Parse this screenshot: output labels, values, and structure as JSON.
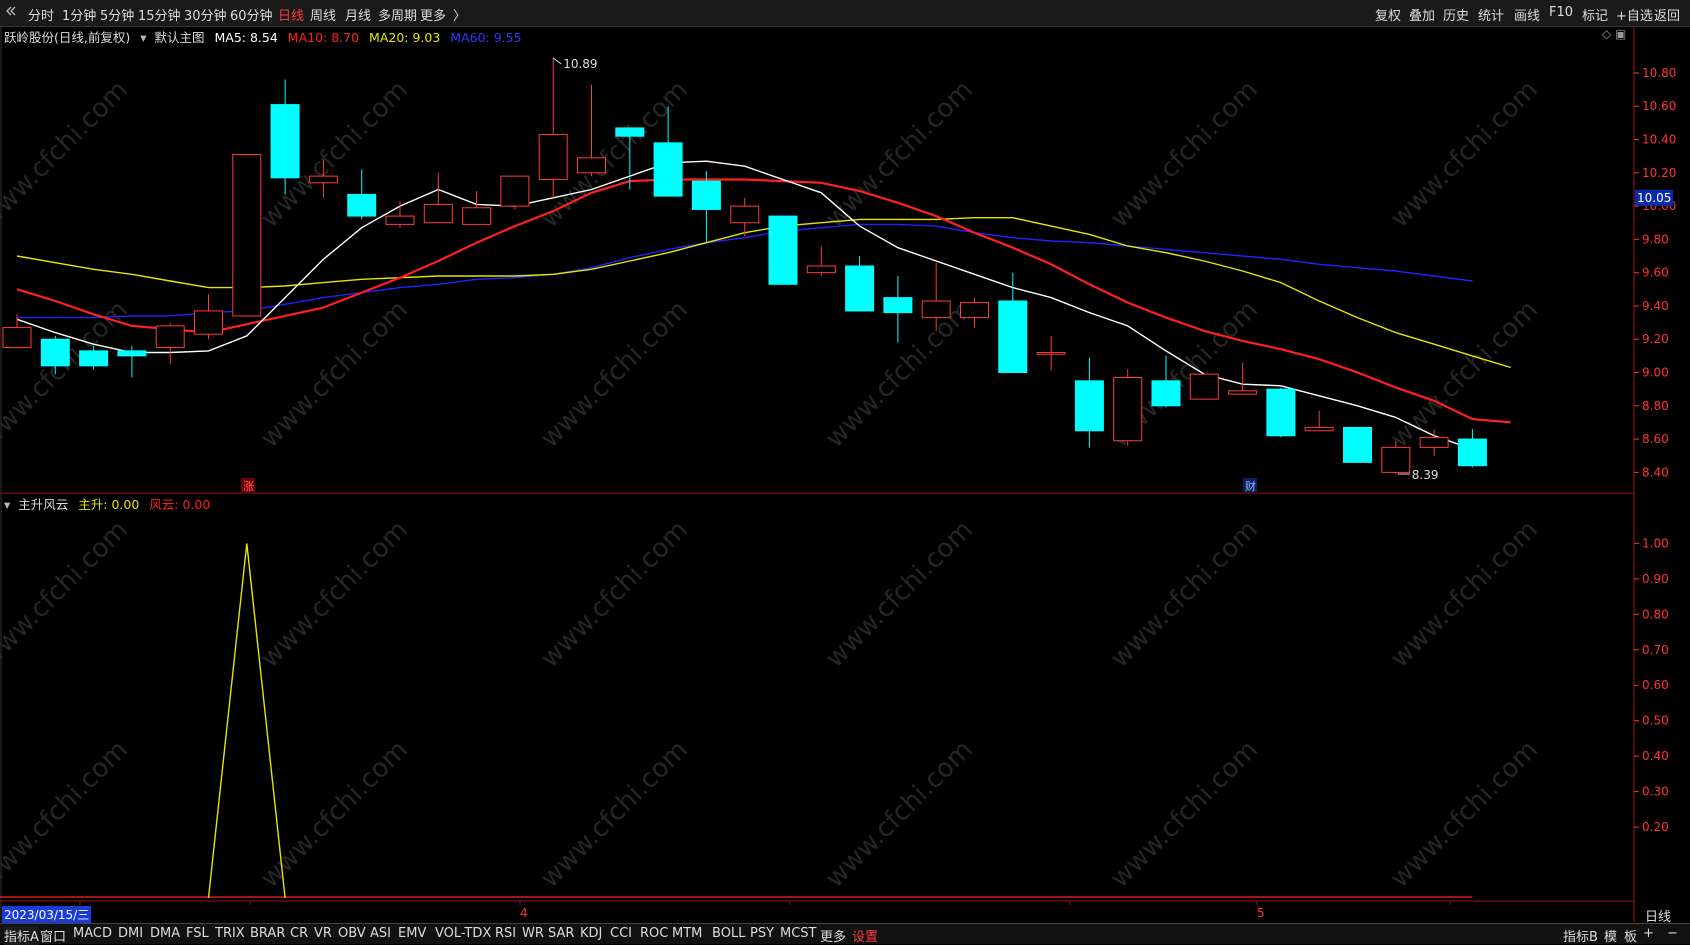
{
  "toolbar_left": [
    "分时",
    "1分钟",
    "5分钟",
    "15分钟",
    "30分钟",
    "60分钟",
    "日线",
    "周线",
    "月线",
    "多周期",
    "更多"
  ],
  "toolbar_active": "日线",
  "toolbar_more_icon": "chevron-right-icon",
  "toolbar_right": [
    "复权",
    "叠加",
    "历史",
    "统计",
    "画线",
    "F10",
    "标记",
    "+自选",
    "返回"
  ],
  "main_chart": {
    "title": "跃岭股份(日线,前复权)",
    "template": "默认主图",
    "ma5_label": "MA5: 8.54",
    "ma10_label": "MA10: 8.70",
    "ma20_label": "MA20: 9.03",
    "ma60_label": "MA60: 9.55",
    "high_annotation": "10.89",
    "low_annotation": "8.39",
    "current_price": "10.05",
    "y_ticks": [
      "10.80",
      "10.60",
      "10.40",
      "10.20",
      "10.00",
      "9.80",
      "9.60",
      "9.40",
      "9.20",
      "9.00",
      "8.80",
      "8.60",
      "8.40"
    ],
    "event_marker_zhang": "涨",
    "event_marker_cai": "财"
  },
  "sub_chart": {
    "title": "主升风云",
    "zhusheng_label": "主升: 0.00",
    "fengyun_label": "风云: 0.00",
    "y_ticks": [
      "1.00",
      "0.90",
      "0.80",
      "0.70",
      "0.60",
      "0.50",
      "0.40",
      "0.30",
      "0.20"
    ]
  },
  "date_label": "2023/03/15/三",
  "month_labels": [
    "4",
    "5"
  ],
  "period_label": "日线",
  "bottom_tabs": [
    "指标A",
    "窗口",
    "MACD",
    "DMI",
    "DMA",
    "FSL",
    "TRIX",
    "BRAR",
    "CR",
    "VR",
    "OBV",
    "ASI",
    "EMV",
    "VOL-TDX",
    "RSI",
    "WR",
    "SAR",
    "KDJ",
    "CCI",
    "ROC",
    "MTM",
    "BOLL",
    "PSY",
    "MCST",
    "更多",
    "设置"
  ],
  "bottom_right": [
    "指标B",
    "模",
    "板",
    "+",
    "−"
  ],
  "watermark": "www.cfchi.com",
  "colors": {
    "up": "#ff3a3a",
    "down": "#00ffff",
    "ma5": "#ffffff",
    "ma10": "#ff2020",
    "ma20": "#e6e600",
    "ma60": "#2222ff",
    "axis": "#ff3333"
  },
  "chart_data": {
    "type": "candlestick",
    "title": "跃岭股份(日线,前复权)",
    "ylim": [
      8.3,
      10.95
    ],
    "candles": [
      {
        "o": 9.15,
        "c": 9.27,
        "h": 9.35,
        "l": 9.15
      },
      {
        "o": 9.2,
        "c": 9.04,
        "h": 9.22,
        "l": 8.99
      },
      {
        "o": 9.13,
        "c": 9.04,
        "h": 9.16,
        "l": 9.02
      },
      {
        "o": 9.13,
        "c": 9.1,
        "h": 9.16,
        "l": 8.97
      },
      {
        "o": 9.15,
        "c": 9.28,
        "h": 9.3,
        "l": 9.05
      },
      {
        "o": 9.23,
        "c": 9.37,
        "h": 9.47,
        "l": 9.2
      },
      {
        "o": 9.34,
        "c": 10.31,
        "h": 10.31,
        "l": 9.34
      },
      {
        "o": 10.61,
        "c": 10.17,
        "h": 10.76,
        "l": 10.07
      },
      {
        "o": 10.14,
        "c": 10.18,
        "h": 10.28,
        "l": 10.05
      },
      {
        "o": 10.07,
        "c": 9.94,
        "h": 10.22,
        "l": 9.92
      },
      {
        "o": 9.89,
        "c": 9.94,
        "h": 10.03,
        "l": 9.87
      },
      {
        "o": 9.9,
        "c": 10.01,
        "h": 10.2,
        "l": 9.9
      },
      {
        "o": 9.89,
        "c": 9.99,
        "h": 10.09,
        "l": 9.89
      },
      {
        "o": 10.0,
        "c": 10.18,
        "h": 10.18,
        "l": 9.98
      },
      {
        "o": 10.16,
        "c": 10.43,
        "h": 10.89,
        "l": 10.05
      },
      {
        "o": 10.2,
        "c": 10.29,
        "h": 10.73,
        "l": 10.18
      },
      {
        "o": 10.47,
        "c": 10.42,
        "h": 10.47,
        "l": 10.1
      },
      {
        "o": 10.38,
        "c": 10.06,
        "h": 10.6,
        "l": 10.06
      },
      {
        "o": 10.15,
        "c": 9.98,
        "h": 10.21,
        "l": 9.78
      },
      {
        "o": 9.9,
        "c": 10.0,
        "h": 10.05,
        "l": 9.82
      },
      {
        "o": 9.94,
        "c": 9.53,
        "h": 9.94,
        "l": 9.53
      },
      {
        "o": 9.6,
        "c": 9.64,
        "h": 9.76,
        "l": 9.58
      },
      {
        "o": 9.64,
        "c": 9.37,
        "h": 9.7,
        "l": 9.37
      },
      {
        "o": 9.45,
        "c": 9.36,
        "h": 9.58,
        "l": 9.18
      },
      {
        "o": 9.33,
        "c": 9.43,
        "h": 9.66,
        "l": 9.25
      },
      {
        "o": 9.33,
        "c": 9.42,
        "h": 9.45,
        "l": 9.27
      },
      {
        "o": 9.43,
        "c": 9.0,
        "h": 9.6,
        "l": 9.0
      },
      {
        "o": 9.11,
        "c": 9.12,
        "h": 9.22,
        "l": 9.01
      },
      {
        "o": 8.95,
        "c": 8.65,
        "h": 9.09,
        "l": 8.55
      },
      {
        "o": 8.59,
        "c": 8.97,
        "h": 9.02,
        "l": 8.56
      },
      {
        "o": 8.95,
        "c": 8.8,
        "h": 9.1,
        "l": 8.79
      },
      {
        "o": 8.84,
        "c": 8.99,
        "h": 8.99,
        "l": 8.84
      },
      {
        "o": 8.87,
        "c": 8.89,
        "h": 9.06,
        "l": 8.87
      },
      {
        "o": 8.9,
        "c": 8.62,
        "h": 8.91,
        "l": 8.61
      },
      {
        "o": 8.65,
        "c": 8.67,
        "h": 8.77,
        "l": 8.65
      },
      {
        "o": 8.67,
        "c": 8.46,
        "h": 8.67,
        "l": 8.46
      },
      {
        "o": 8.4,
        "c": 8.55,
        "h": 8.59,
        "l": 8.39
      },
      {
        "o": 8.55,
        "c": 8.61,
        "h": 8.66,
        "l": 8.5
      },
      {
        "o": 8.6,
        "c": 8.44,
        "h": 8.66,
        "l": 8.43
      }
    ],
    "ma5": [
      9.32,
      9.24,
      9.17,
      9.12,
      9.12,
      9.13,
      9.22,
      9.45,
      9.68,
      9.87,
      10.0,
      10.1,
      10.01,
      10.0,
      10.05,
      10.1,
      10.18,
      10.26,
      10.27,
      10.24,
      10.16,
      10.08,
      9.88,
      9.75,
      9.67,
      9.59,
      9.51,
      9.45,
      9.36,
      9.28,
      9.13,
      8.99,
      8.93,
      8.92,
      8.86,
      8.8,
      8.73,
      8.62,
      8.54
    ],
    "ma10": [
      9.5,
      9.43,
      9.35,
      9.28,
      9.26,
      9.24,
      9.29,
      9.34,
      9.39,
      9.48,
      9.57,
      9.67,
      9.78,
      9.88,
      9.97,
      10.08,
      10.15,
      10.16,
      10.16,
      10.16,
      10.15,
      10.14,
      10.09,
      10.02,
      9.94,
      9.84,
      9.75,
      9.65,
      9.53,
      9.42,
      9.33,
      9.25,
      9.19,
      9.14,
      9.08,
      9.0,
      8.91,
      8.83,
      8.72,
      8.7
    ],
    "ma20": [
      9.7,
      9.66,
      9.62,
      9.59,
      9.55,
      9.51,
      9.51,
      9.52,
      9.54,
      9.56,
      9.57,
      9.58,
      9.58,
      9.58,
      9.59,
      9.62,
      9.67,
      9.72,
      9.78,
      9.84,
      9.88,
      9.9,
      9.92,
      9.92,
      9.92,
      9.93,
      9.93,
      9.88,
      9.83,
      9.76,
      9.72,
      9.67,
      9.61,
      9.54,
      9.43,
      9.33,
      9.24,
      9.17,
      9.1,
      9.03
    ],
    "ma60": [
      9.33,
      9.33,
      9.33,
      9.34,
      9.34,
      9.36,
      9.37,
      9.41,
      9.45,
      9.48,
      9.51,
      9.53,
      9.56,
      9.57,
      9.59,
      9.63,
      9.69,
      9.74,
      9.78,
      9.81,
      9.85,
      9.87,
      9.89,
      9.89,
      9.88,
      9.84,
      9.81,
      9.79,
      9.78,
      9.76,
      9.74,
      9.72,
      9.7,
      9.68,
      9.65,
      9.63,
      9.61,
      9.58,
      9.55
    ],
    "indicator_series": {
      "name": "主升",
      "ylim": [
        0,
        1.08
      ],
      "values": [
        0,
        0,
        0,
        0,
        0,
        0,
        1,
        0,
        0,
        0,
        0,
        0,
        0,
        0,
        0,
        0,
        0,
        0,
        0,
        0,
        0,
        0,
        0,
        0,
        0,
        0,
        0,
        0,
        0,
        0,
        0,
        0,
        0,
        0,
        0,
        0,
        0,
        0,
        0
      ]
    }
  }
}
